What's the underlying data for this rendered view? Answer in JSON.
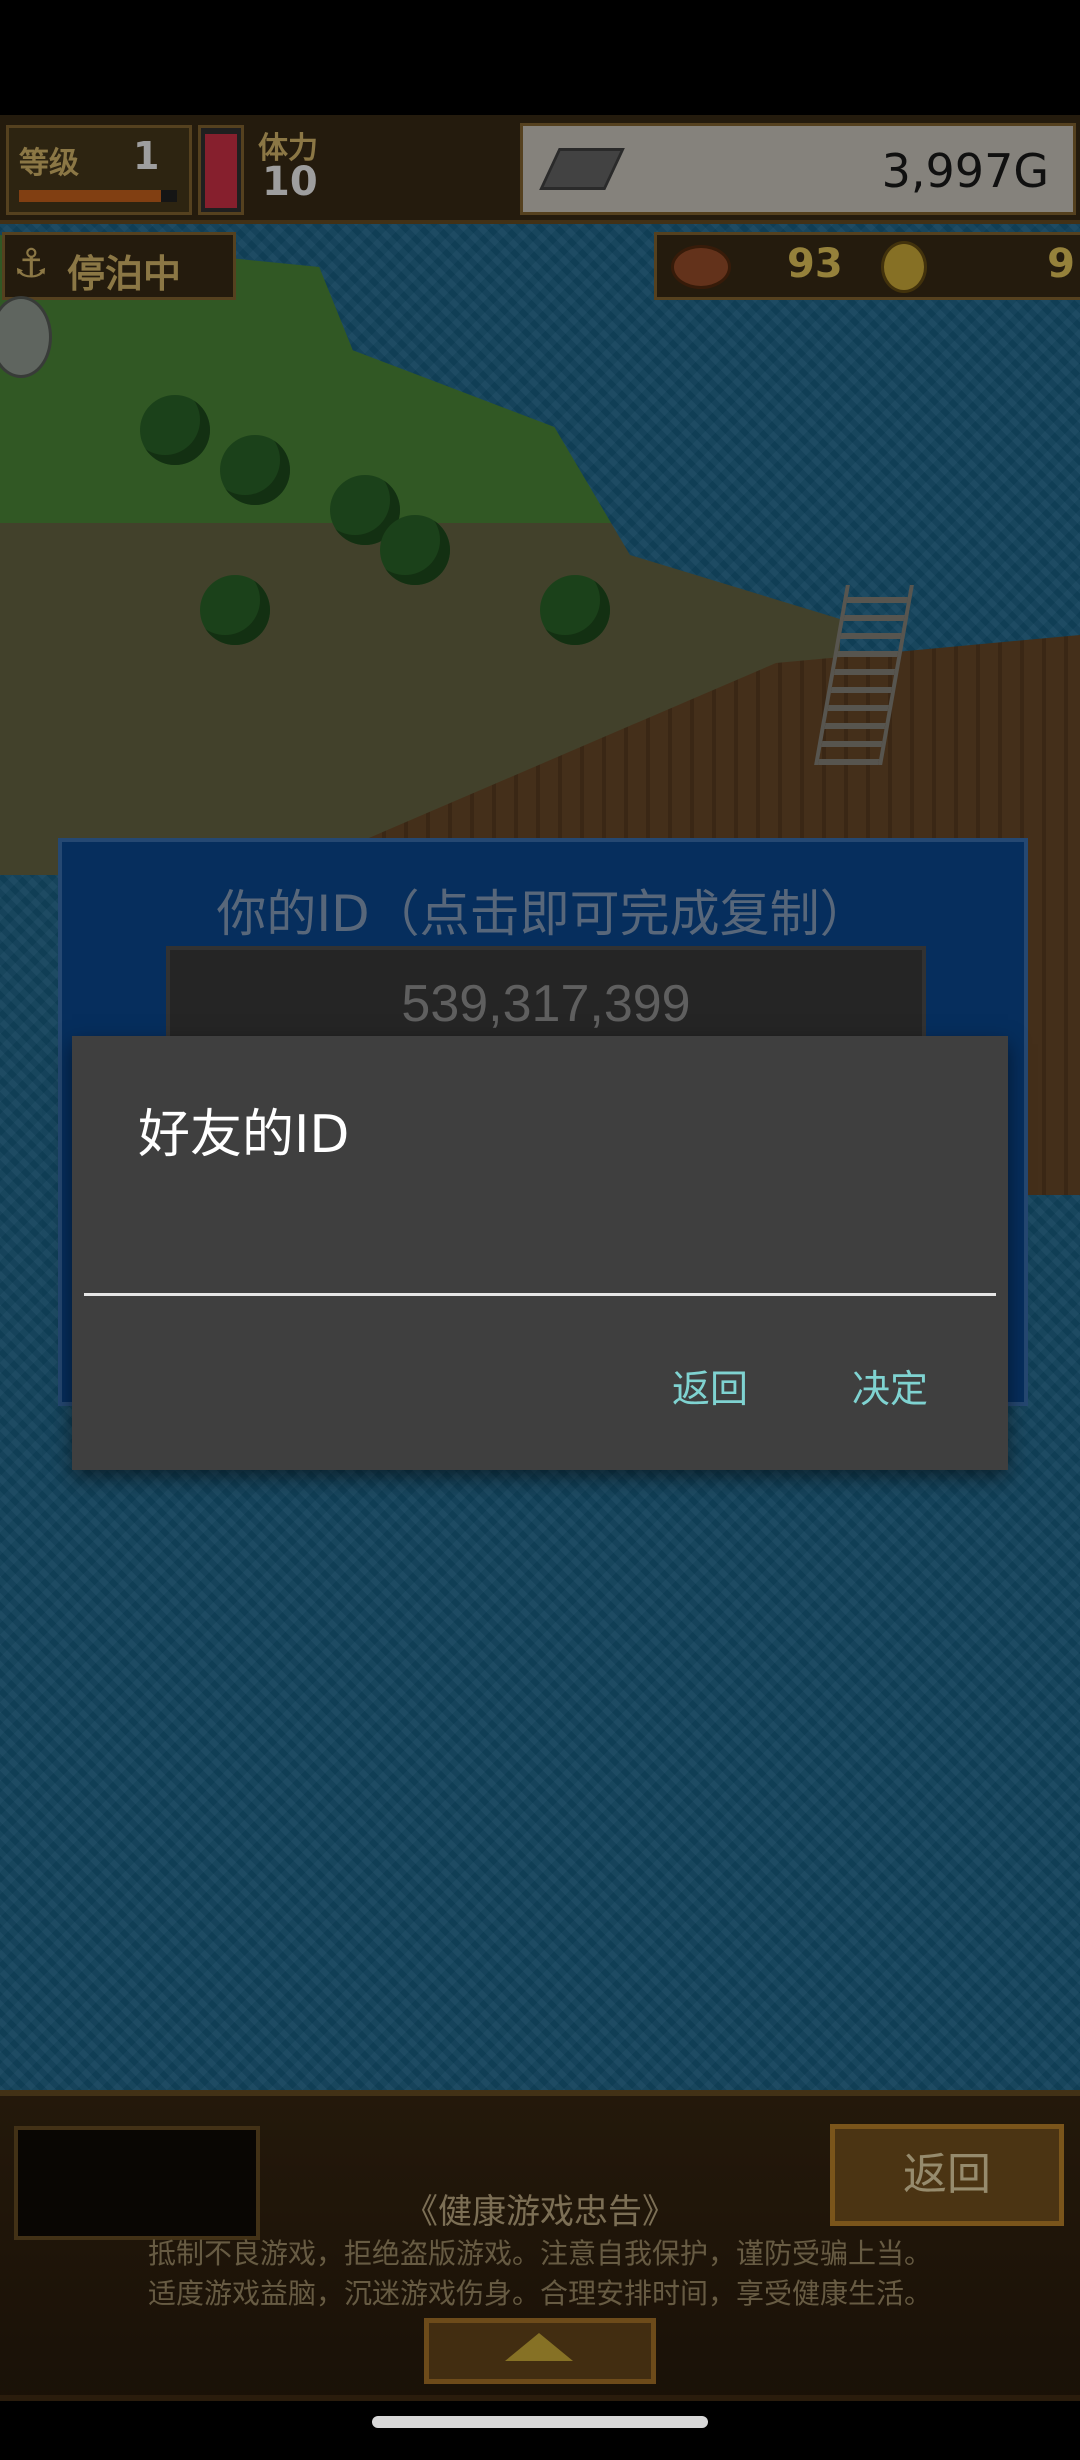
{
  "hud": {
    "level_label": "等级",
    "level_value": "1",
    "stamina_label": "体力",
    "stamina_value": "10",
    "gold_value": "3,997G",
    "docked_label": "停泊中",
    "food_value": "93",
    "coin_value": "9"
  },
  "id_panel": {
    "title": "你的ID（点击即可完成复制）",
    "id_value": "539,317,399"
  },
  "dialog": {
    "title": "好友的ID",
    "input_value": "",
    "back_label": "返回",
    "ok_label": "决定"
  },
  "bottom": {
    "back_label": "返回",
    "health_title": "《健康游戏忠告》",
    "health_line1": "抵制不良游戏，拒绝盗版游戏。注意自我保护，谨防受骗上当。",
    "health_line2": "适度游戏益脑，沉迷游戏伤身。合理安排时间，享受健康生活。"
  },
  "colors": {
    "dialog_bg": "#3f3f3f",
    "dialog_button": "#7fd3d1",
    "panel_blue": "#0a4b96",
    "sea": "#1d6d97"
  },
  "icons": [
    "anchor-icon",
    "silver-bar-icon",
    "food-icon",
    "coin-icon",
    "up-arrow-icon"
  ]
}
